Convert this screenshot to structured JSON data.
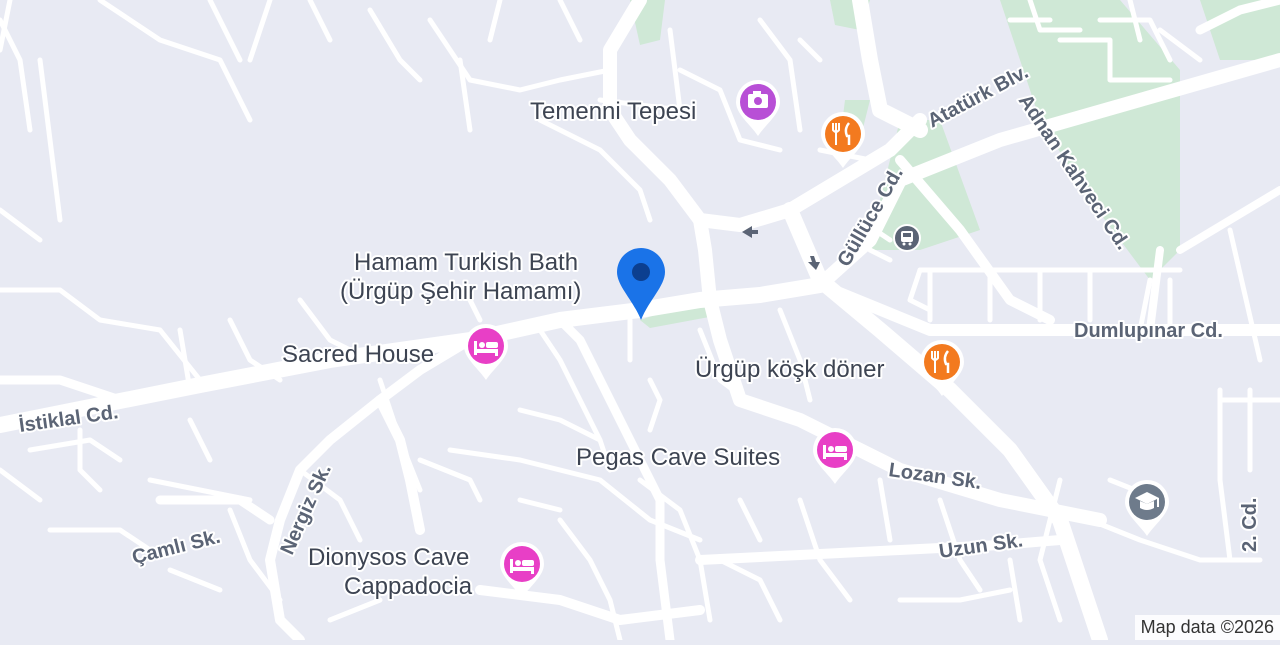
{
  "colors": {
    "background": "#e8eaf3",
    "road": "#ffffff",
    "park": "#cfe8d6",
    "lodging_pin": "#e83fc6",
    "food_pin": "#f37a1f",
    "attraction_pin": "#b84fd6",
    "school_pin": "#6e7b8b",
    "transit_pin": "#5b6475",
    "location_pin": "#1a73e8"
  },
  "roads": {
    "istiklal": "İstiklal Cd.",
    "ataturk": "Atatürk Blv.",
    "adnan_kahveci": "Adnan Kahveci Cd.",
    "gulluce": "Güllüce Cd.",
    "dumlupinar": "Dumlupınar Cd.",
    "lozan": "Lozan Sk.",
    "uzun": "Uzun Sk.",
    "camli": "Çamlı Sk.",
    "nergiz": "Nergiz Sk.",
    "ikinci": "2. Cd."
  },
  "pois": {
    "temenni": {
      "name": "Temenni Tepesi",
      "icon": "camera-icon",
      "category": "attraction"
    },
    "hamam": {
      "name_line1": "Hamam Turkish Bath",
      "name_line2": "(Ürgüp Şehir Hamamı)",
      "icon": "location-pin-icon",
      "category": "selected"
    },
    "sacred": {
      "name": "Sacred House",
      "icon": "bed-icon",
      "category": "lodging"
    },
    "kosk": {
      "name": "Ürgüp köşk döner",
      "icon": "fork-knife-icon",
      "category": "food"
    },
    "pegas": {
      "name": "Pegas Cave Suites",
      "icon": "bed-icon",
      "category": "lodging"
    },
    "dionysos": {
      "name_line1": "Dionysos Cave",
      "name_line2": "Cappadocia",
      "icon": "bed-icon",
      "category": "lodging"
    },
    "restaurant_top": {
      "icon": "fork-knife-icon",
      "category": "food"
    },
    "bus_stop": {
      "icon": "bus-icon",
      "category": "transit"
    },
    "school": {
      "icon": "graduation-cap-icon",
      "category": "education"
    }
  },
  "attribution": "Map data ©2026"
}
